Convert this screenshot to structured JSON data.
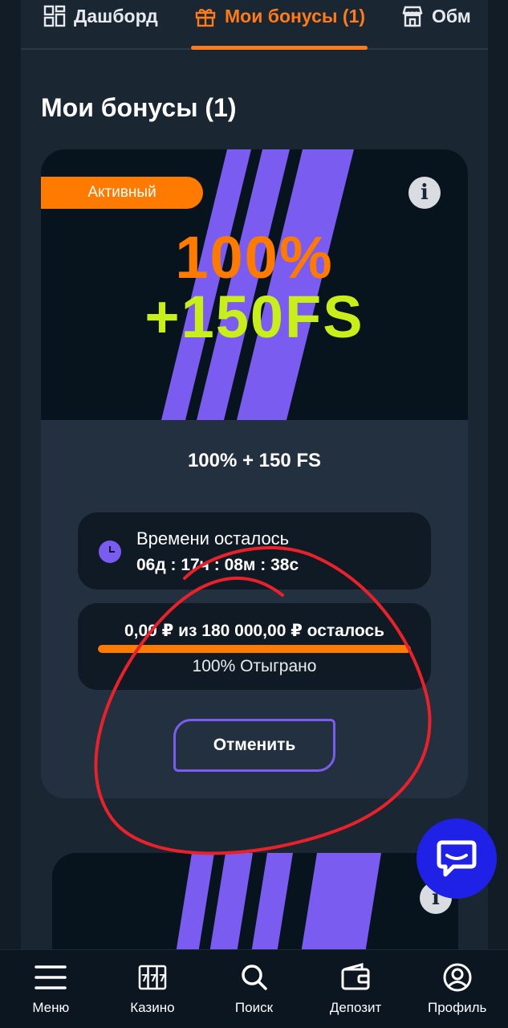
{
  "tabs": [
    {
      "label": "Дашборд",
      "icon": "dashboard-icon"
    },
    {
      "label": "Мои бонусы (1)",
      "icon": "gift-icon",
      "active": true
    },
    {
      "label": "Обм",
      "icon": "shop-icon"
    }
  ],
  "page_title": "Мои бонусы (1)",
  "bonus_card": {
    "badge": "Активный",
    "promo_line1": "100%",
    "promo_line2": "+150FS",
    "name": "100% + 150 FS",
    "timer_label": "Времени осталось",
    "timer_value": "06д : 17ч : 08м : 38с",
    "wager_text": "0,00 ₽ из 180 000,00 ₽ осталось",
    "wager_progress": 1.0,
    "wager_status": "100% Отыграно",
    "cancel_label": "Отменить"
  },
  "bottom_nav": [
    {
      "label": "Меню",
      "icon": "hamburger-icon"
    },
    {
      "label": "Казино",
      "icon": "slot-machine-icon"
    },
    {
      "label": "Поиск",
      "icon": "search-icon"
    },
    {
      "label": "Депозит",
      "icon": "wallet-icon"
    },
    {
      "label": "Профиль",
      "icon": "user-icon"
    }
  ],
  "colors": {
    "accent": "#ff7a00",
    "purple": "#7b5cf0",
    "lime": "#c8ef1a",
    "chat_fab": "#1f22e6",
    "annotation_circle": "#e8212b"
  }
}
